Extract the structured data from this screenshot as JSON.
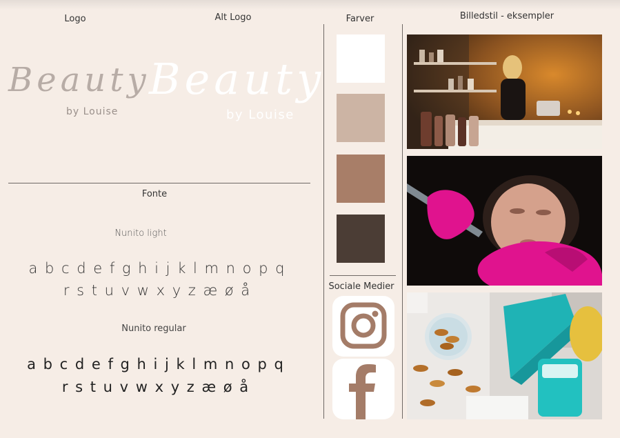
{
  "headings": {
    "logo": "Logo",
    "alt_logo": "Alt Logo",
    "colors": "Farver",
    "image_style": "Billedstil - eksempler",
    "fonts": "Fonte",
    "social": "Sociale Medier"
  },
  "logo": {
    "word": "Beauty",
    "tagline": "by Louise",
    "color": "#b7aca6"
  },
  "alt_logo": {
    "word": "Beauty",
    "tagline": "by Louise",
    "color": "#ffffff"
  },
  "fonts": [
    {
      "name": "Nunito light",
      "line1": "a b c d e f g h i j k l m n o p q",
      "line2": "r s t u v w x y z æ ø å"
    },
    {
      "name": "Nunito regular",
      "line1": "a b c d e f g h i j k l m n o p q",
      "line2": "r s t u v w x y z æ ø å"
    }
  ],
  "colors": [
    "#ffffff",
    "#ccb4a4",
    "#a87e68",
    "#4b3d35"
  ],
  "social": [
    {
      "icon": "instagram-icon",
      "color": "#a47c68"
    },
    {
      "icon": "facebook-icon",
      "color": "#a47c68"
    }
  ],
  "photos": [
    "salon-reception-photo",
    "facial-treatment-photo",
    "skincare-products-photo"
  ]
}
